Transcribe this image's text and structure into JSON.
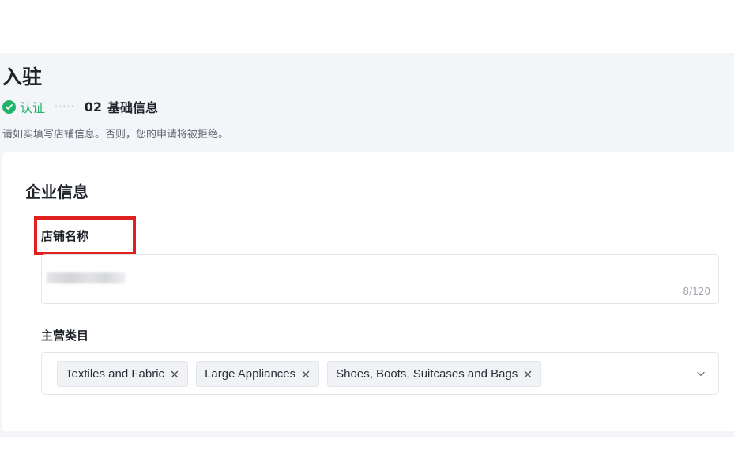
{
  "header": {
    "title": "入驻"
  },
  "steps": {
    "step1_label": "认证",
    "step2_number": "02",
    "step2_label": "基础信息"
  },
  "notice": "请如实填写店铺信息。否则，您的申请将被拒绝。",
  "section": {
    "title": "企业信息"
  },
  "store_name": {
    "label": "店铺名称",
    "counter": "8/120"
  },
  "main_category": {
    "label": "主营类目",
    "tags": [
      "Textiles and Fabric",
      "Large Appliances",
      "Shoes, Boots, Suitcases and Bags"
    ]
  },
  "colors": {
    "accent_success": "#23b26a",
    "highlight": "#e0201f",
    "background_band": "#f4f5f8"
  },
  "icons": {
    "step_check": "check-circle-icon",
    "tag_close": "close-icon",
    "dropdown": "chevron-down-icon"
  }
}
